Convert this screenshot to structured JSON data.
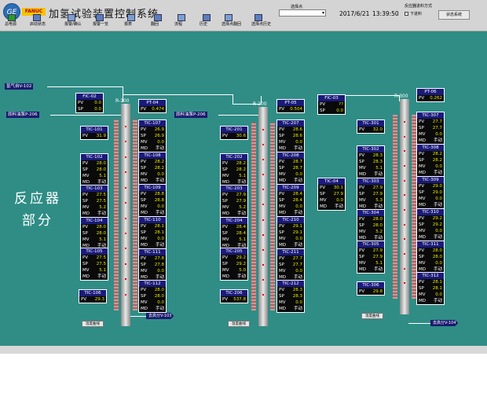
{
  "header": {
    "title": "加氢试验装置控制系统",
    "logo_ge": "GE",
    "logo_fanuc": "FANUC",
    "toolbar": [
      {
        "label": "总电源",
        "icon": "power-icon"
      },
      {
        "label": "启动状态",
        "icon": "status-icon"
      },
      {
        "label": "报警/确认",
        "icon": "alarm-icon"
      },
      {
        "label": "报警一览",
        "icon": "alarm-list-icon"
      },
      {
        "label": "报表",
        "icon": "report-icon"
      },
      {
        "label": "翻回",
        "icon": "zoom-icon"
      },
      {
        "label": "流程",
        "icon": "flow-icon"
      },
      {
        "label": "历史",
        "icon": "history-icon"
      },
      {
        "label": "选择点翻回",
        "icon": "search-point-icon"
      },
      {
        "label": "选择点历史",
        "icon": "trend-icon"
      }
    ],
    "select_label": "选择点",
    "select_value": "",
    "date": "2017/6/21",
    "time": "13:39:50",
    "mode_label": "反应器进料方式",
    "mode_option": "下进料",
    "system_button": "状态系统"
  },
  "main": {
    "section_title_1": "反应器",
    "section_title_2": "部分",
    "feed_tags": {
      "hydrogen": "氢气自V-102",
      "raw": "原料油泵P-206",
      "raw2": "原料油泵P-206",
      "out1": "去高分V-103",
      "out2": "去高分V-104"
    },
    "reactors": [
      {
        "name": "R-100"
      },
      {
        "name": "R-200"
      },
      {
        "name": "R-300"
      }
    ],
    "fic": [
      {
        "tag": "FIC-02",
        "pv_label": "PV",
        "pv": "0.0",
        "sp_label": "SP",
        "sp": "0.0"
      },
      {
        "tag": "FIC-03",
        "pv_label": "PV",
        "pv": "??",
        "sp_label": "SP",
        "sp": "0.0"
      }
    ],
    "pt": [
      {
        "tag": "PT-04",
        "pv_label": "PV",
        "pv": "0.474"
      },
      {
        "tag": "PT-05",
        "pv_label": "PV",
        "pv": "0.504"
      },
      {
        "tag": "PT-06",
        "pv_label": "PV",
        "pv": "0.262"
      }
    ],
    "tic_simple": [
      {
        "tag": "TIC-101",
        "pv": "31.9"
      },
      {
        "tag": "TIC-106",
        "pv": "29.3"
      },
      {
        "tag": "TIC-201",
        "pv": "30.6"
      },
      {
        "tag": "TIC-206",
        "pv": "537.8"
      },
      {
        "tag": "TIC-301",
        "pv": "32.0"
      },
      {
        "tag": "TIC-306",
        "pv": "29.8"
      }
    ],
    "tic_full": [
      {
        "tag": "TIC-107",
        "pv": "26.9",
        "sp": "26.9",
        "mv": "0.0",
        "md": "手动"
      },
      {
        "tag": "TIC-108",
        "pv": "28.2",
        "sp": "28.2",
        "mv": "0.0",
        "md": "手动"
      },
      {
        "tag": "TIC-109",
        "pv": "28.8",
        "sp": "28.8",
        "mv": "0.0",
        "md": "手动"
      },
      {
        "tag": "TIC-110",
        "pv": "28.1",
        "sp": "28.1",
        "mv": "0.0",
        "md": "手动"
      },
      {
        "tag": "TIC-111",
        "pv": "27.8",
        "sp": "27.8",
        "mv": "0.0",
        "md": "手动"
      },
      {
        "tag": "TIC-112",
        "pv": "28.0",
        "sp": "28.0",
        "mv": "0.0",
        "md": "手动"
      },
      {
        "tag": "TIC-102",
        "pv": "28.0",
        "sp": "28.0",
        "mv": "5.1",
        "md": "手动"
      },
      {
        "tag": "TIC-103",
        "pv": "27.5",
        "sp": "27.5",
        "mv": "5.2",
        "md": "手动"
      },
      {
        "tag": "TIC-104",
        "pv": "28.0",
        "sp": "28.0",
        "mv": "5.1",
        "md": "手动"
      },
      {
        "tag": "TIC-105",
        "pv": "27.5",
        "sp": "27.5",
        "mv": "5.1",
        "md": "手动"
      },
      {
        "tag": "TIC-207",
        "pv": "28.6",
        "sp": "28.6",
        "mv": "0.0",
        "md": "手动"
      },
      {
        "tag": "TIC-208",
        "pv": "28.7",
        "sp": "28.7",
        "mv": "0.0",
        "md": "手动"
      },
      {
        "tag": "TIC-209",
        "pv": "28.4",
        "sp": "28.4",
        "mv": "0.0",
        "md": "手动"
      },
      {
        "tag": "TIC-210",
        "pv": "29.1",
        "sp": "29.1",
        "mv": "0.0",
        "md": "手动"
      },
      {
        "tag": "TIC-211",
        "pv": "27.7",
        "sp": "27.7",
        "mv": "0.0",
        "md": "手动"
      },
      {
        "tag": "TIC-212",
        "pv": "28.3",
        "sp": "28.3",
        "mv": "0.0",
        "md": "手动"
      },
      {
        "tag": "TIC-202",
        "pv": "28.2",
        "sp": "28.2",
        "mv": "5.1",
        "md": "手动"
      },
      {
        "tag": "TIC-203",
        "pv": "27.9",
        "sp": "27.9",
        "mv": "5.2",
        "md": "手动"
      },
      {
        "tag": "TIC-204",
        "pv": "28.4",
        "sp": "28.4",
        "mv": "5.1",
        "md": "手动"
      },
      {
        "tag": "TIC-205",
        "pv": "29.2",
        "sp": "29.2",
        "mv": "5.0",
        "md": "手动"
      },
      {
        "tag": "TIC-302",
        "pv": "28.3",
        "sp": "28.3",
        "mv": "5.1",
        "md": "手动"
      },
      {
        "tag": "TIC-303",
        "pv": "27.9",
        "sp": "27.9",
        "mv": "5.3",
        "md": "手动"
      },
      {
        "tag": "TIC-304",
        "pv": "28.0",
        "sp": "28.0",
        "mv": "5.2",
        "md": "手动"
      },
      {
        "tag": "TIC-305",
        "pv": "27.9",
        "sp": "27.9",
        "mv": "5.1",
        "md": "手动"
      },
      {
        "tag": "TIC-307",
        "pv": "27.7",
        "sp": "27.7",
        "mv": "0.0",
        "md": "手动"
      },
      {
        "tag": "TIC-308",
        "pv": "28.2",
        "sp": "28.2",
        "mv": "0.0",
        "md": "手动"
      },
      {
        "tag": "TIC-309",
        "pv": "29.0",
        "sp": "29.0",
        "mv": "0.0",
        "md": "手动"
      },
      {
        "tag": "TIC-310",
        "pv": "29.2",
        "sp": "29.2",
        "mv": "0.0",
        "md": "手动"
      },
      {
        "tag": "TIC-311",
        "pv": "28.0",
        "sp": "28.0",
        "mv": "0.0",
        "md": "手动"
      },
      {
        "tag": "TIC-312",
        "pv": "28.1",
        "sp": "28.1",
        "mv": "0.0",
        "md": "手动"
      }
    ],
    "tic04": {
      "tag": "TIC-04",
      "pv": "30.1",
      "sp": "27.9",
      "mv": "0.0",
      "md": "手动"
    },
    "row_labels": {
      "pv": "PV",
      "sp": "SP",
      "mv": "MV",
      "md": "MD"
    },
    "small_buttons": [
      "温度曲线",
      "温度曲线",
      "温度曲线"
    ]
  }
}
